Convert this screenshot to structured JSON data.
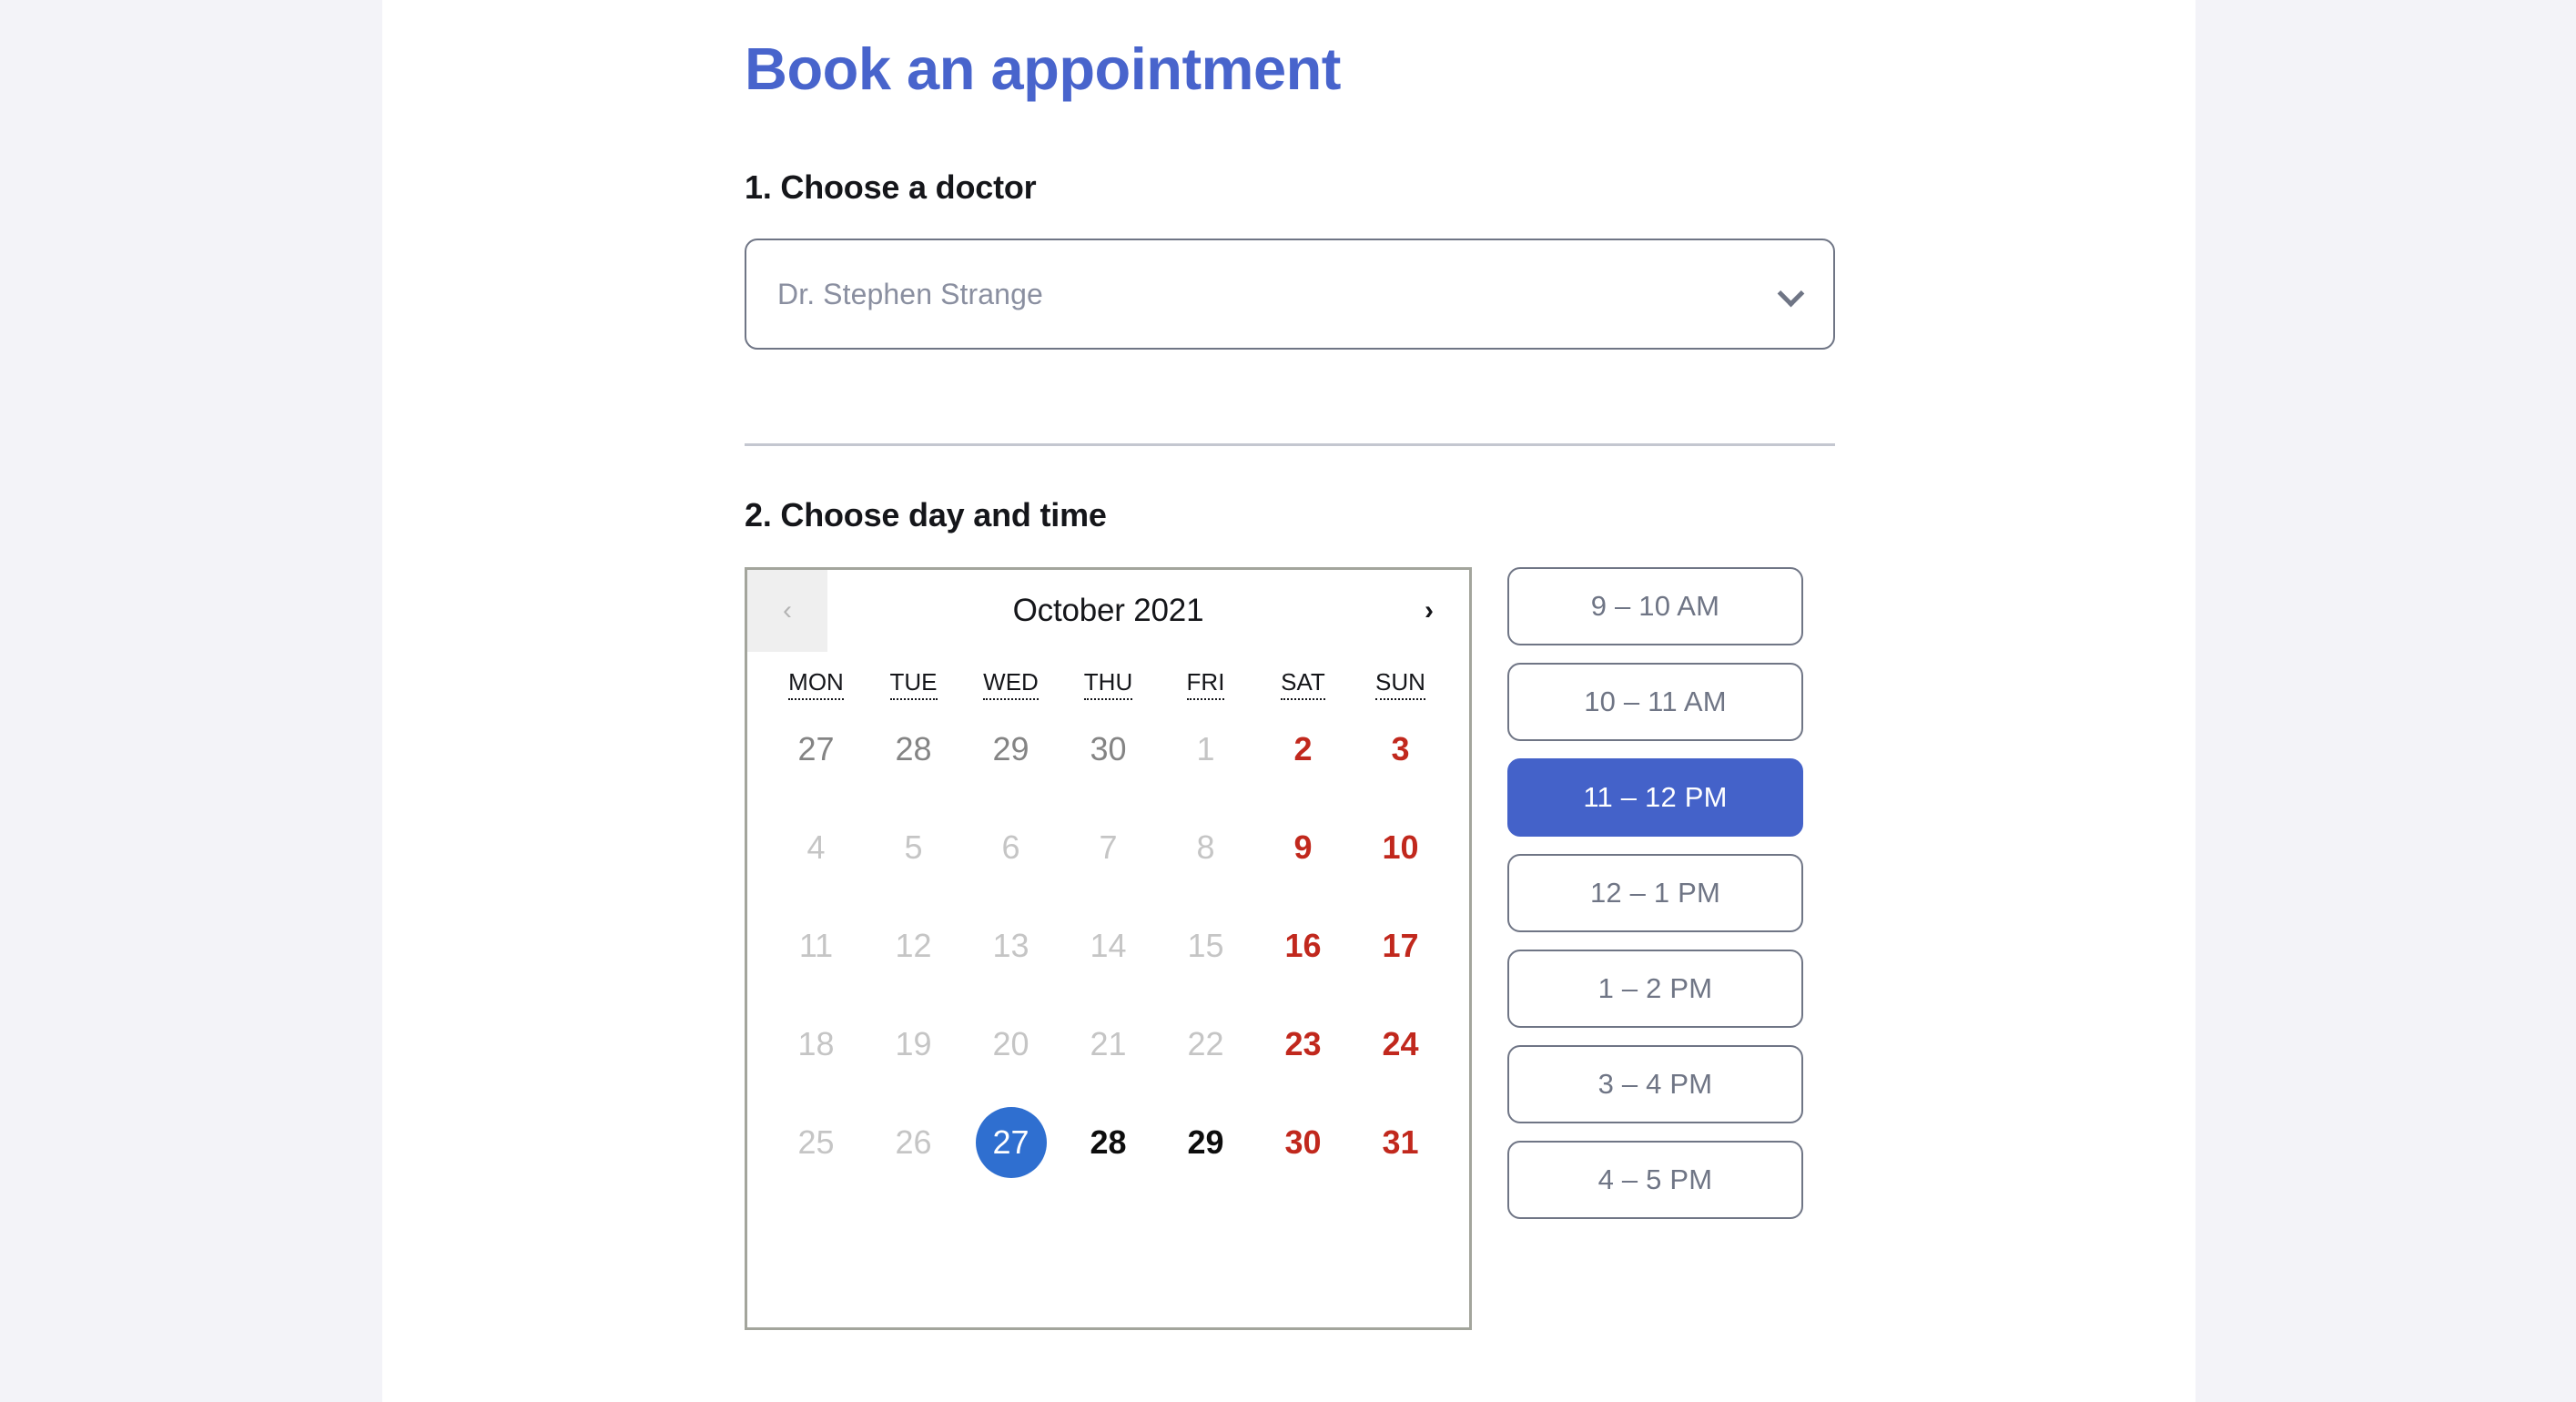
{
  "theme": {
    "page_background": "#f3f3f8",
    "panel_background": "#ffffff",
    "heading_color": "#4864cc",
    "accent_blue": "#4462c9",
    "selected_day_blue": "#2f6fd0",
    "weekend_red": "#c1281d",
    "border_gray": "#6f7585",
    "calendar_border": "#a3a59c"
  },
  "header": {
    "title": "Book an appointment"
  },
  "step1": {
    "heading": "1. Choose a doctor",
    "select": {
      "name": "doctor-select",
      "value": "Dr. Stephen Strange",
      "placeholder": "Dr. Stephen Strange",
      "chevron_icon": "chevron-down-icon"
    }
  },
  "step2": {
    "heading": "2. Choose day and time",
    "calendar": {
      "month_label": "October 2021",
      "prev_icon": "chevron-left-icon",
      "prev_label": "‹",
      "prev_disabled": true,
      "next_icon": "chevron-right-icon",
      "next_label": "›",
      "next_disabled": false,
      "weekdays": [
        "MON",
        "TUE",
        "WED",
        "THU",
        "FRI",
        "SAT",
        "SUN"
      ],
      "selected_day": "27",
      "weeks": [
        [
          {
            "label": "27",
            "state": "other"
          },
          {
            "label": "28",
            "state": "other"
          },
          {
            "label": "29",
            "state": "other"
          },
          {
            "label": "30",
            "state": "other"
          },
          {
            "label": "1",
            "state": "muted"
          },
          {
            "label": "2",
            "state": "weekend muted"
          },
          {
            "label": "3",
            "state": "weekend muted"
          }
        ],
        [
          {
            "label": "4",
            "state": "muted"
          },
          {
            "label": "5",
            "state": "muted"
          },
          {
            "label": "6",
            "state": "muted"
          },
          {
            "label": "7",
            "state": "muted"
          },
          {
            "label": "8",
            "state": "muted"
          },
          {
            "label": "9",
            "state": "weekend muted"
          },
          {
            "label": "10",
            "state": "weekend muted"
          }
        ],
        [
          {
            "label": "11",
            "state": "muted"
          },
          {
            "label": "12",
            "state": "muted"
          },
          {
            "label": "13",
            "state": "muted"
          },
          {
            "label": "14",
            "state": "muted"
          },
          {
            "label": "15",
            "state": "muted"
          },
          {
            "label": "16",
            "state": "weekend muted"
          },
          {
            "label": "17",
            "state": "weekend muted"
          }
        ],
        [
          {
            "label": "18",
            "state": "muted"
          },
          {
            "label": "19",
            "state": "muted"
          },
          {
            "label": "20",
            "state": "muted"
          },
          {
            "label": "21",
            "state": "muted"
          },
          {
            "label": "22",
            "state": "muted"
          },
          {
            "label": "23",
            "state": "weekend muted"
          },
          {
            "label": "24",
            "state": "weekend muted"
          }
        ],
        [
          {
            "label": "25",
            "state": "muted"
          },
          {
            "label": "26",
            "state": "muted"
          },
          {
            "label": "27",
            "state": "selected"
          },
          {
            "label": "28",
            "state": "avail"
          },
          {
            "label": "29",
            "state": "avail"
          },
          {
            "label": "30",
            "state": "weekend"
          },
          {
            "label": "31",
            "state": "weekend"
          }
        ]
      ]
    },
    "time_slots": [
      {
        "label": "9 – 10 AM",
        "selected": false
      },
      {
        "label": "10 – 11 AM",
        "selected": false
      },
      {
        "label": "11 – 12 PM",
        "selected": true
      },
      {
        "label": "12 – 1 PM",
        "selected": false
      },
      {
        "label": "1 – 2 PM",
        "selected": false
      },
      {
        "label": "3 – 4 PM",
        "selected": false
      },
      {
        "label": "4 – 5 PM",
        "selected": false
      }
    ]
  }
}
